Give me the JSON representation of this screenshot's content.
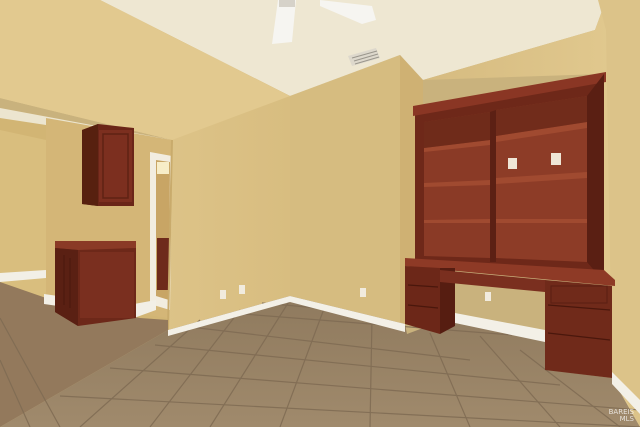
{
  "image": {
    "subject": "empty-room-interior",
    "watermark_text": "BAREIS\nMLS"
  },
  "colors": {
    "ceiling": "#efe9d6",
    "wall_left": "#dcc389",
    "wall_center": "#d9bf84",
    "wall_right": "#dcc48b",
    "wall_shadow": "#cdb174",
    "floor_tile": "#9b8466",
    "floor_grout": "#7d6a52",
    "cabinet_wood": "#7a2e1f",
    "cabinet_dark": "#5c2016",
    "cabinet_light": "#8e3a26",
    "baseboard": "#f4f1e8",
    "hallway_wall": "#d6b778"
  }
}
